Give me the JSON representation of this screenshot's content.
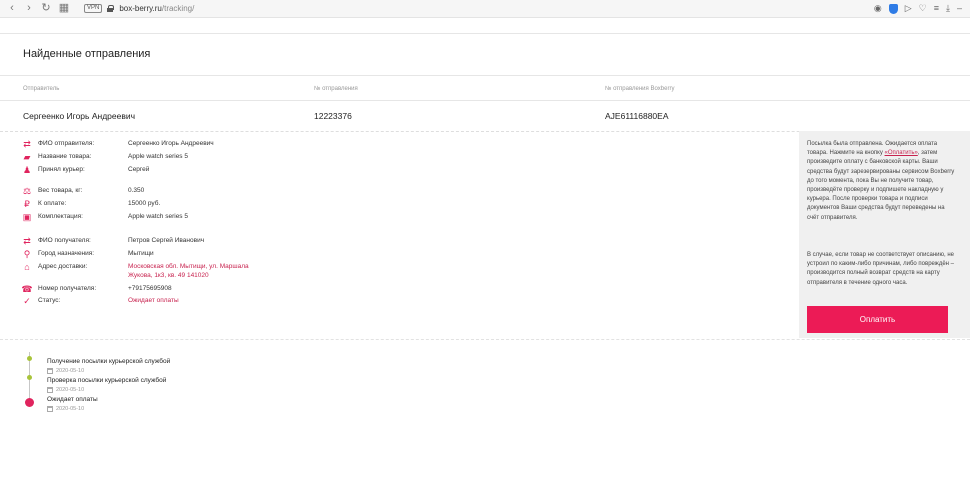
{
  "browser": {
    "back": "‹",
    "forward": "›",
    "reload": "↻",
    "tabs_icon": "▦",
    "vpn_label": "VPN",
    "url_host": "box-berry.ru",
    "url_path": "/tracking/"
  },
  "page": {
    "title": "Найденные отправления"
  },
  "table": {
    "headers": [
      "Отправитель",
      "№ отправления",
      "№ отправления Boxberry"
    ],
    "row": [
      "Сергеенко Игорь Андреевич",
      "12223376",
      "AJE61116880EA"
    ]
  },
  "details": [
    {
      "icon": "exchange-icon",
      "glyph": "⇄",
      "label": "ФИО отправителя:",
      "value": "Сергеенко Игорь Андреевич",
      "red": false
    },
    {
      "icon": "truck-icon",
      "glyph": "▰",
      "label": "Название товара:",
      "value": "Apple watch series 5",
      "red": false
    },
    {
      "icon": "courier-icon",
      "glyph": "♟",
      "label": "Принял курьер:",
      "value": "Сергей",
      "red": false
    },
    {
      "icon": "weight-icon",
      "glyph": "⚖",
      "label": "Вес товара, кг:",
      "value": "0.350",
      "red": false
    },
    {
      "icon": "ruble-icon",
      "glyph": "₽",
      "label": "К оплате:",
      "value": "15000 руб.",
      "red": false
    },
    {
      "icon": "box-icon",
      "glyph": "▣",
      "label": "Комплектация:",
      "value": "Apple watch series 5",
      "red": false
    },
    {
      "icon": "exchange-icon",
      "glyph": "⇄",
      "label": "ФИО получателя:",
      "value": "Петров Сергей Иванович",
      "red": false
    },
    {
      "icon": "location-icon",
      "glyph": "⚲",
      "label": "Город назначения:",
      "value": "Мытищи",
      "red": false
    },
    {
      "icon": "home-icon",
      "glyph": "⌂",
      "label": "Адрес доставки:",
      "value": "Московская обл. Мытищи, ул. Маршала",
      "value2": "Жукова, 1к3, кв. 49 141020",
      "red": true
    },
    {
      "icon": "phone-icon",
      "glyph": "☎",
      "label": "Номер получателя:",
      "value": "+79175695908",
      "red": false
    },
    {
      "icon": "check-icon",
      "glyph": "✓",
      "label": "Статус:",
      "value": "Ожидает оплаты",
      "red": true
    }
  ],
  "info": {
    "p1_before": "Посылка была отправлена. Ожидается оплата товара. Нажмите на кнопку ",
    "p1_link": "«Оплатить»",
    "p1_after": ", затем произведите оплату с банковской карты. Ваши средства будут зарезервированы сервисом Boxberry до того момента, пока Вы не получите товар, произведёте проверку и подпишете накладную у курьера. После проверки товара и подписи документов Ваши средства будут переведены на счёт отправителя.",
    "p2": "В случае, если товар не соответствует описанию, не устроил по каким-либо причинам, либо повреждён – производится полный возврат средств на карту отправителя в течение одного часа.",
    "pay_label": "Оплатить"
  },
  "timeline": [
    {
      "title": "Получение посылки курьерской службой",
      "date": "2020-05-10",
      "color": "#a8c43a"
    },
    {
      "title": "Проверка посылки курьерской службой",
      "date": "2020-05-10",
      "color": "#a8c43a"
    },
    {
      "title": "Ожидает оплаты",
      "date": "2020-05-10",
      "color": "#e0245e"
    }
  ],
  "colors": {
    "accent": "#ec1b56",
    "icon": "#e0245e",
    "timeline_done": "#a8c43a"
  }
}
